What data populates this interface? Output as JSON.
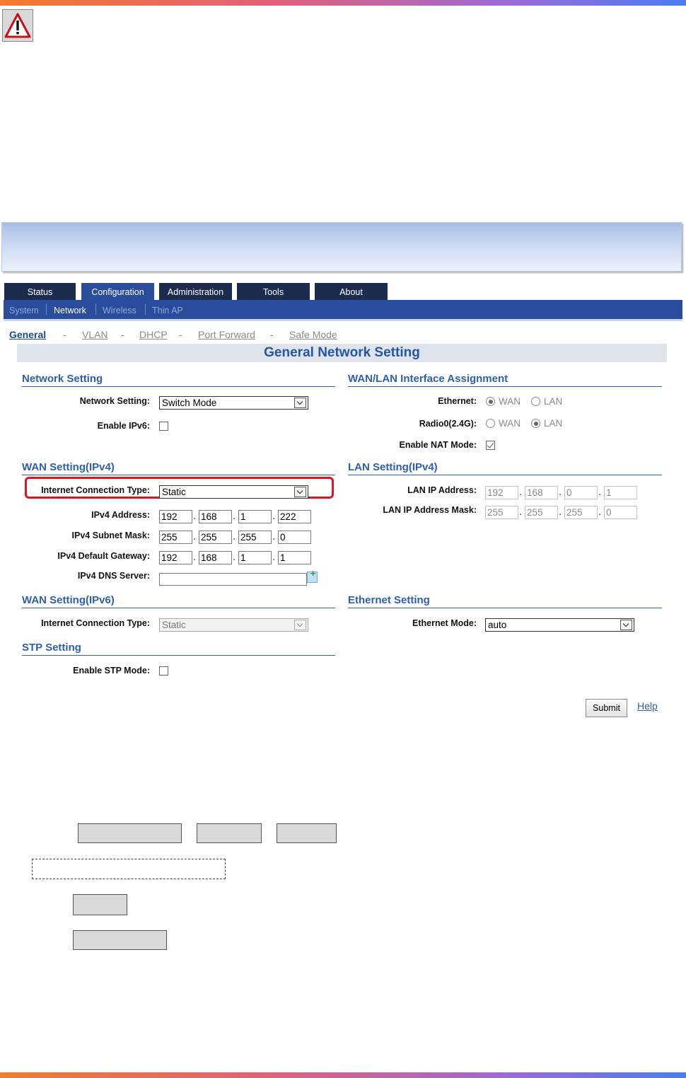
{
  "nav": {
    "tabs": [
      {
        "label": "Status"
      },
      {
        "label": "Configuration"
      },
      {
        "label": "Administration"
      },
      {
        "label": "Tools"
      },
      {
        "label": "About"
      }
    ],
    "subtabs": [
      {
        "label": "System"
      },
      {
        "label": "Network"
      },
      {
        "label": "Wireless"
      },
      {
        "label": "Thin AP"
      }
    ],
    "pagelinks": [
      {
        "label": "General"
      },
      {
        "label": "VLAN"
      },
      {
        "label": "DHCP"
      },
      {
        "label": "Port Forward"
      },
      {
        "label": "Safe Mode"
      }
    ],
    "separator": "-"
  },
  "page_title": "General Network Setting",
  "network_setting": {
    "heading": "Network Setting",
    "mode_label": "Network Setting:",
    "mode_value": "Switch Mode",
    "ipv6_label": "Enable IPv6:"
  },
  "wan_ipv4": {
    "heading": "WAN Setting(IPv4)",
    "conn_label": "Internet Connection Type:",
    "conn_value": "Static",
    "ip_label": "IPv4 Address:",
    "ip": [
      "192",
      "168",
      "1",
      "222"
    ],
    "mask_label": "IPv4 Subnet Mask:",
    "mask": [
      "255",
      "255",
      "255",
      "0"
    ],
    "gw_label": "IPv4 Default Gateway:",
    "gw": [
      "192",
      "168",
      "1",
      "1"
    ],
    "dns_label": "IPv4 DNS Server:",
    "dns_value": ""
  },
  "wan_ipv6": {
    "heading": "WAN Setting(IPv6)",
    "conn_label": "Internet Connection Type:",
    "conn_value": "Static"
  },
  "stp": {
    "heading": "STP Setting",
    "label": "Enable STP Mode:"
  },
  "wanlan": {
    "heading": "WAN/LAN Interface Assignment",
    "ethernet_label": "Ethernet:",
    "radio_label": "Radio0(2.4G):",
    "opt_wan": "WAN",
    "opt_lan": "LAN",
    "nat_label": "Enable NAT Mode:"
  },
  "lan_ipv4": {
    "heading": "LAN Setting(IPv4)",
    "ip_label": "LAN IP Address:",
    "ip": [
      "192",
      "168",
      "0",
      "1"
    ],
    "mask_label": "LAN IP Address Mask:",
    "mask": [
      "255",
      "255",
      "255",
      "0"
    ]
  },
  "ethernet": {
    "heading": "Ethernet Setting",
    "mode_label": "Ethernet Mode:",
    "mode_value": "auto"
  },
  "actions": {
    "submit": "Submit",
    "help": "Help"
  },
  "dot": "."
}
